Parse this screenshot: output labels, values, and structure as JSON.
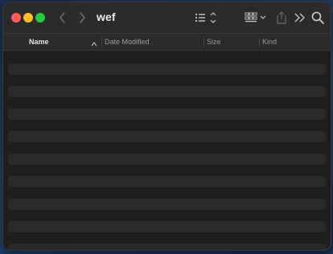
{
  "window": {
    "title": "wef"
  },
  "toolbar": {
    "icons": [
      "back-chevron-icon",
      "forward-chevron-icon",
      "list-view-icon",
      "sort-updown-icon",
      "group-grid-icon",
      "dropdown-chevron-icon",
      "share-icon",
      "more-chevrons-icon",
      "search-icon"
    ]
  },
  "columns": {
    "name": "Name",
    "date_modified": "Date Modified",
    "size": "Size",
    "kind": "Kind"
  },
  "colors": {
    "close": "#ff5f57",
    "minimize": "#febc2e",
    "maximize": "#28c840",
    "background": "#1e1e1e",
    "toolbar": "#2b2b2b"
  }
}
